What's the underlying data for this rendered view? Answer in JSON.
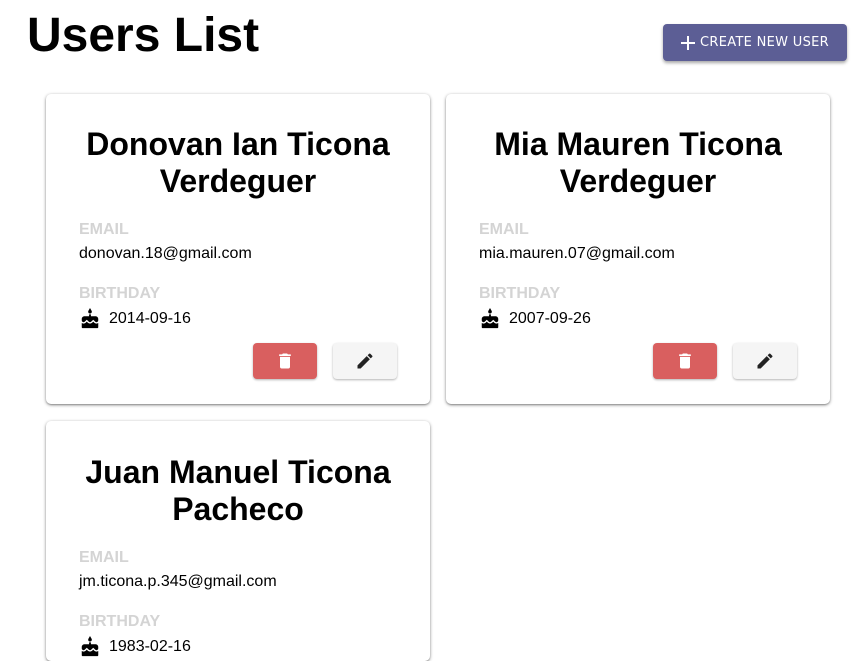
{
  "header": {
    "title": "Users List",
    "create_label": "CREATE NEW USER"
  },
  "colors": {
    "primary": "#5c5e95",
    "danger": "#d95f5f",
    "label_gray": "#d4d4d4"
  },
  "users": [
    {
      "name": "Donovan Ian Ticona Verdeguer",
      "email_label": "EMAIL",
      "email": "donovan.18@gmail.com",
      "birthday_label": "BIRTHDAY",
      "birthday": "2014-09-16"
    },
    {
      "name": "Mia Mauren Ticona Verdeguer",
      "email_label": "EMAIL",
      "email": "mia.mauren.07@gmail.com",
      "birthday_label": "BIRTHDAY",
      "birthday": "2007-09-26"
    },
    {
      "name": "Juan Manuel Ticona Pacheco",
      "email_label": "EMAIL",
      "email": "jm.ticona.p.345@gmail.com",
      "birthday_label": "BIRTHDAY",
      "birthday": "1983-02-16"
    }
  ]
}
